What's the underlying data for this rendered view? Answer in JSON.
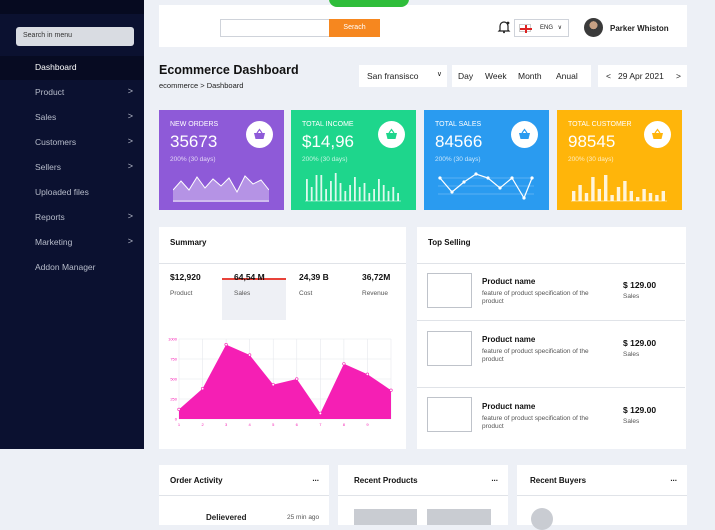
{
  "sidebar": {
    "search_label": "Search in menu",
    "items": [
      {
        "label": "Dashboard",
        "chevron": ""
      },
      {
        "label": "Product",
        "chevron": ">"
      },
      {
        "label": "Sales",
        "chevron": ">"
      },
      {
        "label": "Customers",
        "chevron": ">"
      },
      {
        "label": "Sellers",
        "chevron": ">"
      },
      {
        "label": "Uploaded files",
        "chevron": ""
      },
      {
        "label": "Reports",
        "chevron": ">"
      },
      {
        "label": "Marketing",
        "chevron": ">"
      },
      {
        "label": "Addon Manager",
        "chevron": ""
      }
    ]
  },
  "topbar": {
    "search_button": "Serach",
    "language": "ENG",
    "user_name": "Parker Whiston"
  },
  "page": {
    "title": "Ecommerce Dashboard",
    "breadcrumb": "ecommerce > Dashboard",
    "city": "San fransisco",
    "periods": [
      "Day",
      "Week",
      "Month",
      "Anual"
    ],
    "date": "29 Apr 2021",
    "date_prev": "<",
    "date_next": ">"
  },
  "cards": [
    {
      "label": "NEW ORDERS",
      "value": "35673",
      "sub": "200% (30 days)",
      "color": "#8e5ad8",
      "icon": "basket-icon",
      "spark": "area"
    },
    {
      "label": "TOTAL INCOME",
      "value": "$14,96",
      "sub": "200% (30 days)",
      "color": "#1ed68c",
      "icon": "basket-icon",
      "spark": "bars"
    },
    {
      "label": "TOTAL SALES",
      "value": "84566",
      "sub": "200% (30 days)",
      "color": "#2a9bf0",
      "icon": "basket-icon",
      "spark": "line"
    },
    {
      "label": "TOTAL CUSTOMER",
      "value": "98545",
      "sub": "200% (30 days)",
      "color": "#ffb50a",
      "icon": "basket-icon",
      "spark": "bars"
    }
  ],
  "summary": {
    "title": "Summary",
    "stats": [
      {
        "value": "$12,920",
        "label": "Product"
      },
      {
        "value": "64,54 M",
        "label": "Sales"
      },
      {
        "value": "24,39 B",
        "label": "Cost"
      },
      {
        "value": "36,72M",
        "label": "Revenue"
      }
    ]
  },
  "chart_data": {
    "type": "area",
    "x": [
      1,
      2,
      3,
      4,
      5,
      6,
      7,
      8,
      9
    ],
    "y_ticks": [
      "1000",
      "750",
      "500",
      "250",
      "0"
    ],
    "values": [
      120,
      380,
      930,
      800,
      430,
      500,
      70,
      690,
      560,
      360
    ],
    "ylim": [
      0,
      1000
    ],
    "color": "#f51fb4"
  },
  "top_selling": {
    "title": "Top Selling",
    "items": [
      {
        "name": "Product name",
        "desc": "feature of product specification of the product",
        "price": "$ 129.00",
        "sales": "Sales"
      },
      {
        "name": "Product name",
        "desc": "feature of product specification of the product",
        "price": "$ 129.00",
        "sales": "Sales"
      },
      {
        "name": "Product name",
        "desc": "feature of product specification of the product",
        "price": "$ 129.00",
        "sales": "Sales"
      }
    ]
  },
  "order_activity": {
    "title": "Order Activity",
    "more": "...",
    "row_status": "Delievered",
    "row_time": "25 min ago"
  },
  "recent_products": {
    "title": "Recent Products",
    "more": "..."
  },
  "recent_buyers": {
    "title": "Recent Buyers",
    "more": "..."
  }
}
